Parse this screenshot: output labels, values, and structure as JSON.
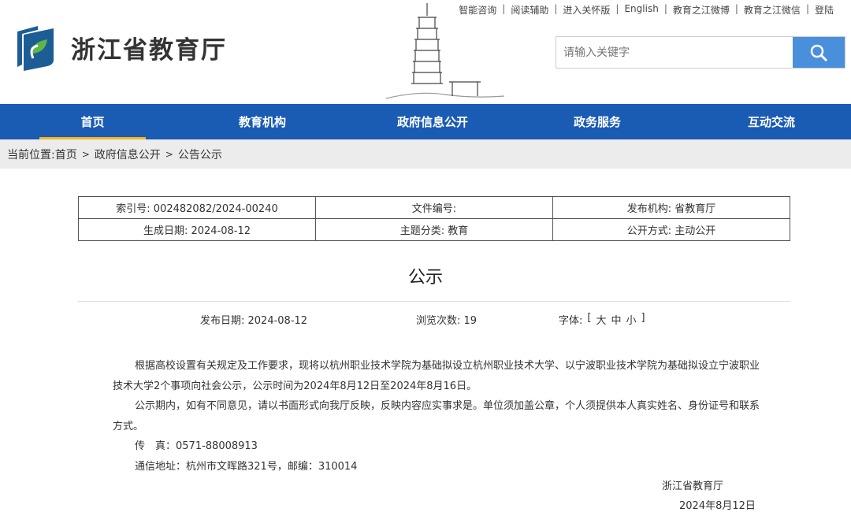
{
  "top_links": [
    "智能咨询",
    "阅读辅助",
    "进入关怀版",
    "English",
    "教育之江微博",
    "教育之江微信",
    "登陆"
  ],
  "site_title": "浙江省教育厅",
  "search": {
    "placeholder": "请输入关键字"
  },
  "nav": [
    "首页",
    "教育机构",
    "政府信息公开",
    "政务服务",
    "互动交流"
  ],
  "breadcrumb": {
    "prefix": "当前位置:",
    "items": [
      "首页",
      "政府信息公开",
      "公告公示"
    ],
    "sep": ">"
  },
  "meta": [
    [
      "索引号: 002482082/2024-00240",
      "文件编号:",
      "发布机构: 省教育厅"
    ],
    [
      "生成日期: 2024-08-12",
      "主题分类: 教育",
      "公开方式: 主动公开"
    ]
  ],
  "article": {
    "title": "公示",
    "publish_date": "发布日期: 2024-08-12",
    "views": "浏览次数: 19",
    "font_label": "字体:",
    "font_sizes": [
      "[",
      "大",
      "中",
      "小",
      "]"
    ],
    "paragraphs": [
      "根据高校设置有关规定及工作要求，现将以杭州职业技术学院为基础拟设立杭州职业技术大学、以宁波职业技术学院为基础拟设立宁波职业技术大学2个事项向社会公示，公示时间为2024年8月12日至2024年8月16日。",
      "公示期内，如有不同意见，请以书面形式向我厅反映，反映内容应实事求是。单位须加盖公章，个人须提供本人真实姓名、身份证号和联系方式。",
      "传　真：0571-88008913",
      "通信地址：杭州市文晖路321号，邮编：310014"
    ],
    "signature": "浙江省教育厅",
    "sign_date": "2024年8月12日"
  },
  "colors": {
    "nav": "#1a5bb3",
    "active_underline": "#f3b623",
    "search_button": "#4a8fdb"
  }
}
